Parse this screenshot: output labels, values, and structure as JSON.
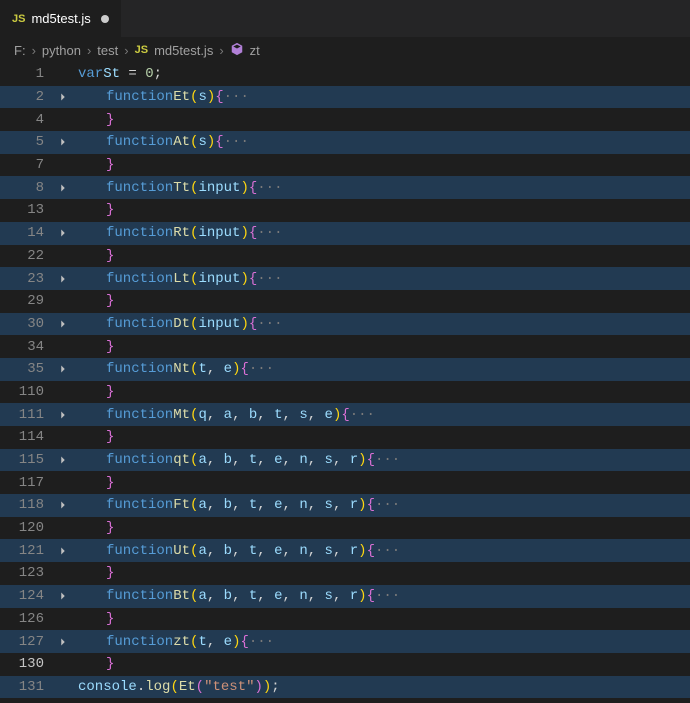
{
  "tab": {
    "badge_text": "JS",
    "name": "md5test.js"
  },
  "breadcrumb": {
    "segments": [
      "F:",
      "python",
      "test"
    ],
    "file_badge": "JS",
    "file": "md5test.js",
    "symbol": "zt"
  },
  "tokens": {
    "kw_var": "var",
    "kw_function": "function",
    "num_zero": "0",
    "sym_eq": " = ",
    "sym_semi": ";",
    "sym_lbrace": "{",
    "sym_rbrace": "}",
    "sym_lparen": "(",
    "sym_rparen": ")",
    "sym_comma": ", ",
    "ellipsis": "···",
    "name_St": "St",
    "console": "console",
    "log": "log",
    "dot": ".",
    "str_test": "\"test\"",
    "p_s": "s",
    "p_input": "input",
    "p_t": "t",
    "p_e": "e",
    "p_q": "q",
    "p_a": "a",
    "p_b": "b",
    "p_n": "n",
    "p_r": "r"
  },
  "lines": [
    {
      "num": "1",
      "fold": false,
      "type": "var"
    },
    {
      "num": "2",
      "fold": true,
      "type": "func_open",
      "name": "Et",
      "params": [
        "p_s"
      ]
    },
    {
      "num": "4",
      "fold": false,
      "type": "close"
    },
    {
      "num": "5",
      "fold": true,
      "type": "func_open",
      "name": "At",
      "params": [
        "p_s"
      ]
    },
    {
      "num": "7",
      "fold": false,
      "type": "close"
    },
    {
      "num": "8",
      "fold": true,
      "type": "func_open",
      "name": "Tt",
      "params": [
        "p_input"
      ]
    },
    {
      "num": "13",
      "fold": false,
      "type": "close"
    },
    {
      "num": "14",
      "fold": true,
      "type": "func_open",
      "name": "Rt",
      "params": [
        "p_input"
      ]
    },
    {
      "num": "22",
      "fold": false,
      "type": "close"
    },
    {
      "num": "23",
      "fold": true,
      "type": "func_open",
      "name": "Lt",
      "params": [
        "p_input"
      ]
    },
    {
      "num": "29",
      "fold": false,
      "type": "close"
    },
    {
      "num": "30",
      "fold": true,
      "type": "func_open",
      "name": "Dt",
      "params": [
        "p_input"
      ]
    },
    {
      "num": "34",
      "fold": false,
      "type": "close"
    },
    {
      "num": "35",
      "fold": true,
      "type": "func_open",
      "name": "Nt",
      "params": [
        "p_t",
        "p_e"
      ]
    },
    {
      "num": "110",
      "fold": false,
      "type": "close"
    },
    {
      "num": "111",
      "fold": true,
      "type": "func_open",
      "name": "Mt",
      "params": [
        "p_q",
        "p_a",
        "p_b",
        "p_t",
        "p_s",
        "p_e"
      ]
    },
    {
      "num": "114",
      "fold": false,
      "type": "close"
    },
    {
      "num": "115",
      "fold": true,
      "type": "func_open",
      "name": "qt",
      "params": [
        "p_a",
        "p_b",
        "p_t",
        "p_e",
        "p_n",
        "p_s",
        "p_r"
      ]
    },
    {
      "num": "117",
      "fold": false,
      "type": "close"
    },
    {
      "num": "118",
      "fold": true,
      "type": "func_open",
      "name": "Ft",
      "params": [
        "p_a",
        "p_b",
        "p_t",
        "p_e",
        "p_n",
        "p_s",
        "p_r"
      ]
    },
    {
      "num": "120",
      "fold": false,
      "type": "close"
    },
    {
      "num": "121",
      "fold": true,
      "type": "func_open",
      "name": "Ut",
      "params": [
        "p_a",
        "p_b",
        "p_t",
        "p_e",
        "p_n",
        "p_s",
        "p_r"
      ]
    },
    {
      "num": "123",
      "fold": false,
      "type": "close"
    },
    {
      "num": "124",
      "fold": true,
      "type": "func_open",
      "name": "Bt",
      "params": [
        "p_a",
        "p_b",
        "p_t",
        "p_e",
        "p_n",
        "p_s",
        "p_r"
      ]
    },
    {
      "num": "126",
      "fold": false,
      "type": "close"
    },
    {
      "num": "127",
      "fold": true,
      "type": "func_open",
      "name": "zt",
      "params": [
        "p_t",
        "p_e"
      ]
    },
    {
      "num": "130",
      "fold": false,
      "type": "close",
      "cur": true
    },
    {
      "num": "131",
      "fold": false,
      "type": "console"
    }
  ]
}
